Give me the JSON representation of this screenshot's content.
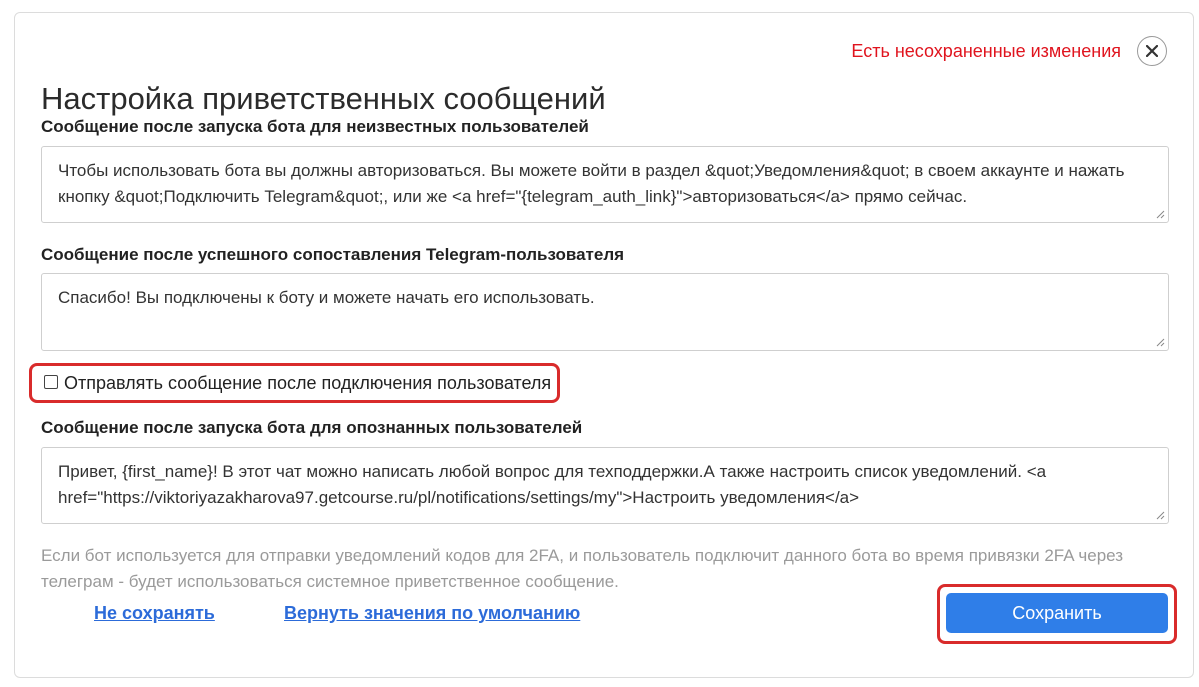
{
  "header": {
    "unsaved_notice": "Есть несохраненные изменения",
    "title": "Настройка приветственных сообщений"
  },
  "fields": {
    "unknown_users": {
      "label": "Сообщение после запуска бота для неизвестных пользователей",
      "value": "Чтобы использовать бота вы должны авторизоваться. Вы можете войти в раздел &quot;Уведомления&quot; в своем аккаунте и нажать кнопку &quot;Подключить Telegram&quot;, или же <a href=\"{telegram_auth_link}\">авторизоваться</a> прямо сейчас."
    },
    "matched_user": {
      "label": "Сообщение после успешного сопоставления Telegram-пользователя",
      "value": "Спасибо! Вы подключены к боту и можете начать его использовать."
    },
    "send_after_connect": {
      "label": "Отправлять сообщение после подключения пользователя",
      "checked": false
    },
    "known_users": {
      "label": "Сообщение после запуска бота для опознанных пользователей",
      "value": "Привет, {first_name}! В этот чат можно написать любой вопрос для техподдержки.А также настроить список уведомлений. <a href=\"https://viktoriyazakharova97.getcourse.ru/pl/notifications/settings/my\">Настроить уведомления</a>"
    }
  },
  "hint": "Если бот используется для отправки уведомлений кодов для 2FA, и пользователь подключит данного бота во время привязки 2FA через телеграм - будет использоваться системное приветственное сообщение.",
  "actions": {
    "dont_save": "Не сохранять",
    "restore_defaults": "Вернуть значения по умолчанию",
    "save": "Сохранить"
  },
  "colors": {
    "accent": "#2f7ee8",
    "link": "#2c6bd9",
    "warning": "#e0141e",
    "highlight": "#d92b2b"
  }
}
